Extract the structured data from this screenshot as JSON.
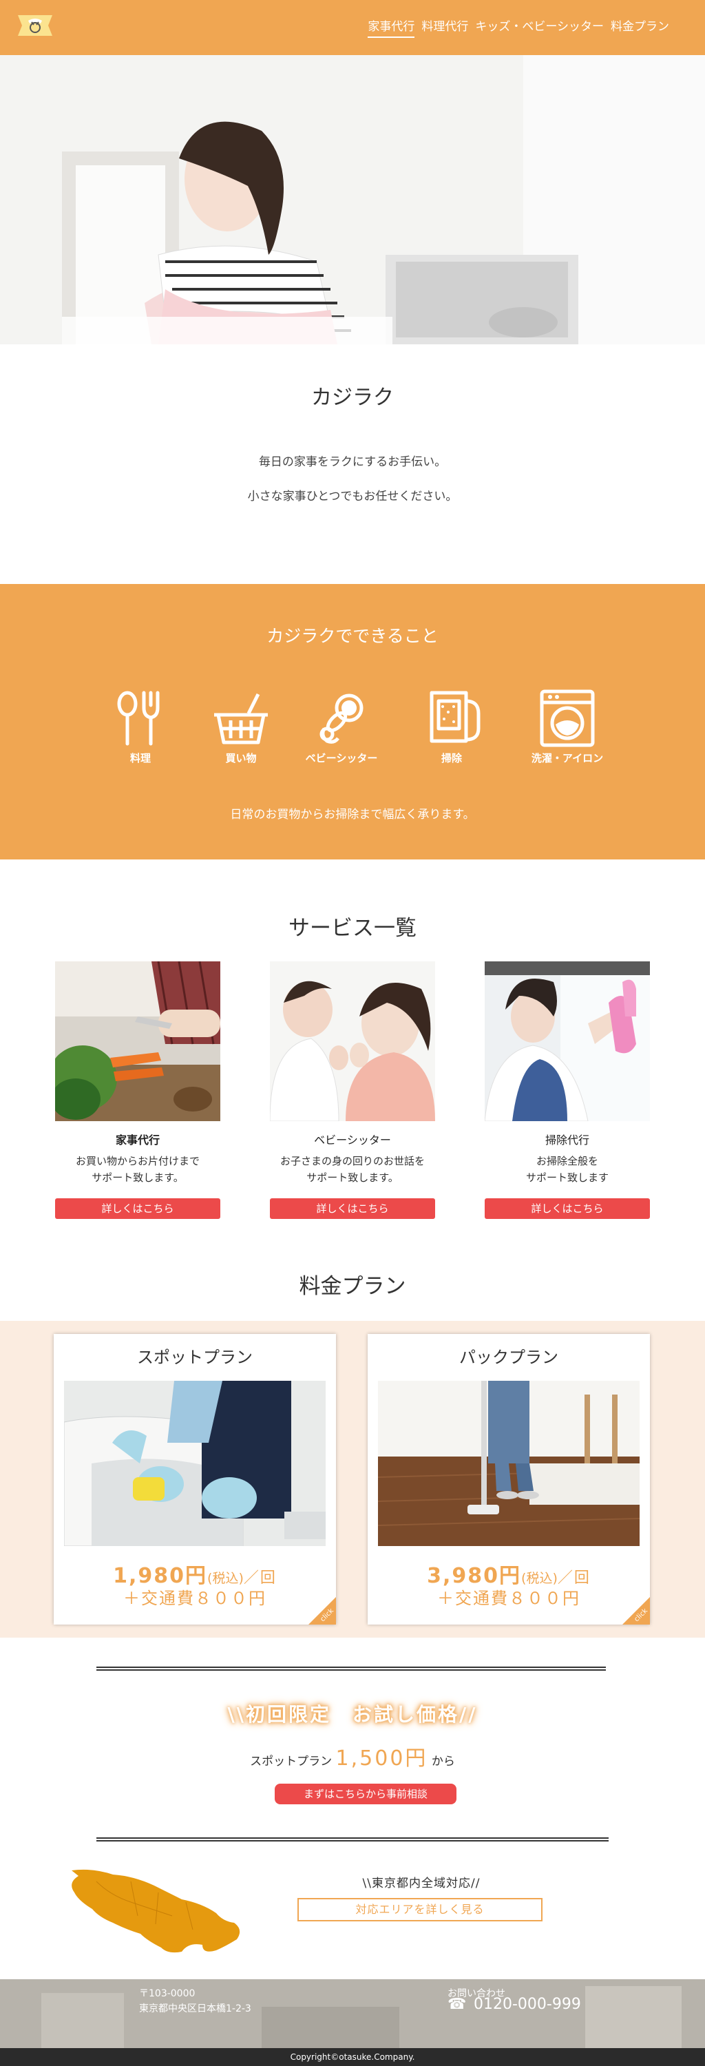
{
  "header": {
    "logo": "kajiraku-logo",
    "nav": [
      "家事代行",
      "料理代行",
      "キッズ・ベビーシッター",
      "料金プラン"
    ]
  },
  "intro": {
    "title": "カジラク",
    "lines": [
      "毎日の家事をラクにするお手伝い。",
      "小さな家事ひとつでもお任せください。"
    ]
  },
  "cando": {
    "title": "カジラクでできること",
    "items": [
      {
        "label": "料理",
        "icon": "cooking-utensils-icon"
      },
      {
        "label": "買い物",
        "icon": "shopping-basket-icon"
      },
      {
        "label": "ベビーシッター",
        "icon": "baby-pacifier-icon"
      },
      {
        "label": "掃除",
        "icon": "cleaning-bucket-icon"
      },
      {
        "label": "洗濯・アイロン",
        "icon": "washing-machine-icon"
      }
    ],
    "text": "日常のお買物からお掃除まで幅広く承ります。"
  },
  "services": {
    "title": "サービス一覧",
    "items": [
      {
        "name": "家事代行",
        "desc1": "お買い物からお片付けまで",
        "desc2": "サポート致します。",
        "button": "詳しくはこちら"
      },
      {
        "name": "ベビーシッター",
        "desc1": "お子さまの身の回りのお世話を",
        "desc2": "サポート致します。",
        "button": "詳しくはこちら"
      },
      {
        "name": "掃除代行",
        "desc1": "お掃除全般を",
        "desc2": "サポート致します",
        "button": "詳しくはこちら"
      }
    ]
  },
  "plans": {
    "title": "料金プラン",
    "items": [
      {
        "name": "スポットプラン",
        "price": "1,980円",
        "tax": "(税込)",
        "per": "／回",
        "fee": "＋交通費８００円",
        "corner": "click"
      },
      {
        "name": "パックプラン",
        "price": "3,980円",
        "tax": "(税込)",
        "per": "／回",
        "fee": "＋交通費８００円",
        "corner": "click"
      }
    ]
  },
  "campaign": {
    "title": "\\\\初回限定　お試し価格//",
    "plan_prefix": "スポットプラン",
    "plan_price": "1,500円",
    "plan_suffix": "から",
    "button": "まずはこちらから事前相談"
  },
  "area": {
    "label": "\\\\東京都内全域対応//",
    "button": "対応エリアを詳しく見る"
  },
  "footer": {
    "postal": "〒103-0000",
    "address": "東京都中央区日本橋1-2-3",
    "contact_label": "お問い合わせ",
    "phone": "0120-000-999",
    "phone_icon": "telephone-icon",
    "copyright": "Copyright©otasuke.Company."
  },
  "colors": {
    "accent": "#f0a652",
    "button": "#ec4a4a",
    "plan_bg": "#fbece0",
    "footer": "#b9b5ad"
  }
}
